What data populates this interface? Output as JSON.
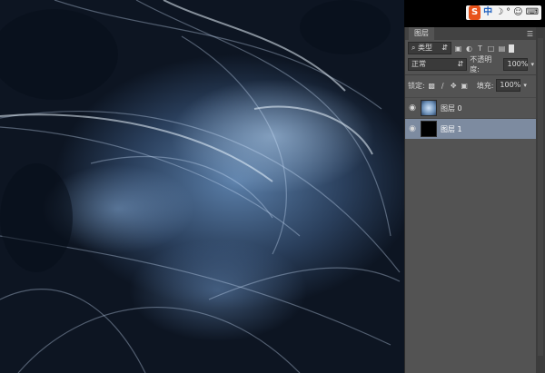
{
  "ime": {
    "logo": "S",
    "lang": "中",
    "items": [
      "☽",
      "°",
      "☺",
      "⌨"
    ]
  },
  "panel": {
    "tab_label": "图层",
    "filter": {
      "kind_label": "类型"
    },
    "blend": {
      "mode": "正常",
      "opacity_label": "不透明度:",
      "opacity_value": "100%"
    },
    "lock": {
      "label": "锁定:",
      "fill_label": "填充:",
      "fill_value": "100%"
    },
    "layers": [
      {
        "name": "图层 0",
        "thumb": "image",
        "selected": false
      },
      {
        "name": "图层 1",
        "thumb": "black",
        "selected": true
      }
    ]
  }
}
